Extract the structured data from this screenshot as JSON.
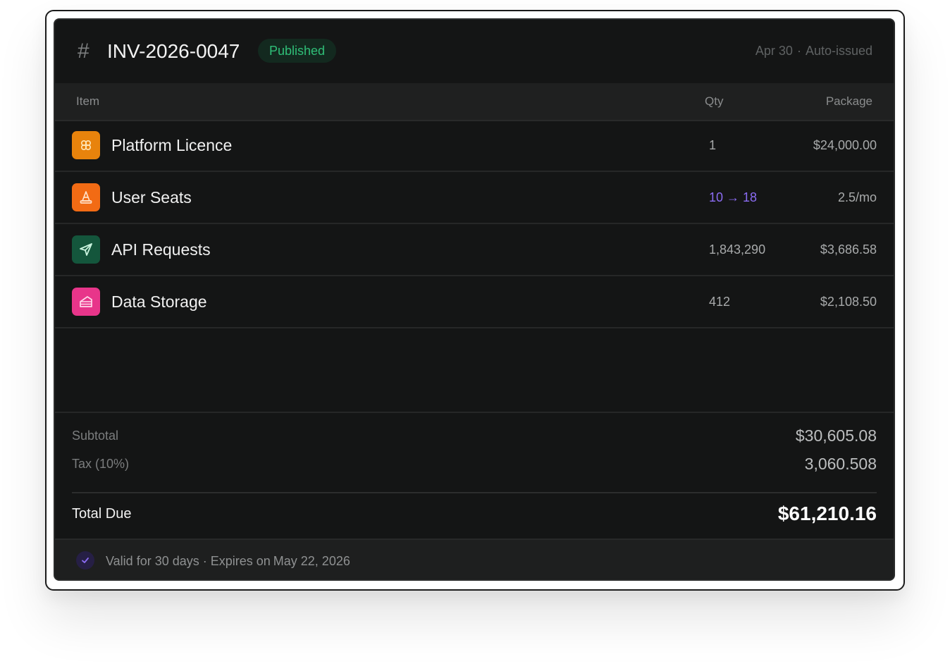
{
  "invoice": {
    "hash_symbol": "#",
    "number": "INV-2026-0047",
    "status": "Published",
    "date": "Apr 30",
    "separator": "·",
    "issue_mode": "Auto-issued"
  },
  "table": {
    "columns": [
      "Item",
      "Qty",
      "Package"
    ],
    "rows": [
      {
        "name": "Platform Licence",
        "qty": "1",
        "package": "$24,000.00",
        "icon": "cluster-icon",
        "icon_color": "#e8830c"
      },
      {
        "name": "User Seats",
        "qty": "10 → 18",
        "package": "2.5/mo",
        "icon": "traffic-cone-icon",
        "icon_color": "#f26b14"
      },
      {
        "name": "API Requests",
        "qty": "1,843,290",
        "package": "$3,686.58",
        "icon": "send-arrow-icon",
        "icon_color": "#14563c"
      },
      {
        "name": "Data Storage",
        "qty": "412",
        "package": "$2,108.50",
        "icon": "cake-slice-icon",
        "icon_color": "#e8358a"
      }
    ]
  },
  "totals": {
    "subtotal_label": "Subtotal",
    "subtotal_value": "$30,605.08",
    "tax_label": "Tax (10%)",
    "tax_value": "3,060.508",
    "total_label": "Total Due",
    "total_value": "$61,210.16"
  },
  "footer": {
    "text": "Valid for 30 days · Expires on",
    "date": "May 22, 2026",
    "icon": "check-icon"
  },
  "colors": {
    "status_green": "#2fbf78",
    "qty_accent": "#8b6cf3",
    "card_bg": "#141515"
  }
}
